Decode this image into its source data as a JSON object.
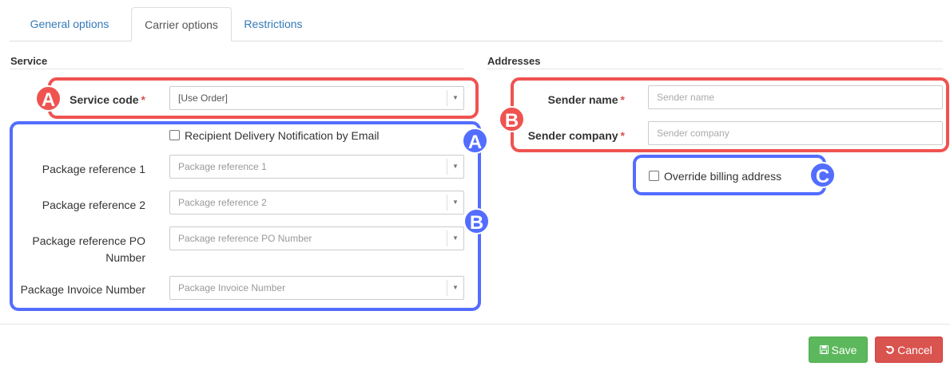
{
  "tabs": [
    {
      "label": "General options",
      "active": false
    },
    {
      "label": "Carrier options",
      "active": true
    },
    {
      "label": "Restrictions",
      "active": false
    }
  ],
  "service": {
    "title": "Service",
    "service_code": {
      "label": "Service code",
      "required_mark": "*",
      "value": "[Use Order]"
    },
    "notification_checkbox": {
      "label": "Recipient Delivery Notification by Email",
      "checked": false
    },
    "package_ref_1": {
      "label": "Package reference 1",
      "placeholder": "Package reference 1"
    },
    "package_ref_2": {
      "label": "Package reference 2",
      "placeholder": "Package reference 2"
    },
    "package_ref_po": {
      "label_line1": "Package reference PO",
      "label_line2": "Number",
      "placeholder": "Package reference PO Number"
    },
    "package_invoice": {
      "label": "Package Invoice Number",
      "placeholder": "Package Invoice Number"
    }
  },
  "addresses": {
    "title": "Addresses",
    "sender_name": {
      "label": "Sender name",
      "required_mark": "*",
      "placeholder": "Sender name"
    },
    "sender_company": {
      "label": "Sender company",
      "required_mark": "*",
      "placeholder": "Sender company"
    },
    "override_billing": {
      "label": "Override billing address",
      "checked": false
    }
  },
  "annotations": {
    "red_a": "A",
    "red_b": "B",
    "blue_a": "A",
    "blue_b": "B",
    "blue_c": "C"
  },
  "buttons": {
    "save": {
      "label": "Save",
      "icon": "floppy-disk-icon"
    },
    "cancel": {
      "label": "Cancel",
      "icon": "undo-icon"
    }
  },
  "colors": {
    "annotation_red": "#ef5350",
    "annotation_blue": "#536dfe",
    "save_green": "#5cb85c",
    "cancel_red": "#d9534f",
    "link_blue": "#337ab7"
  }
}
